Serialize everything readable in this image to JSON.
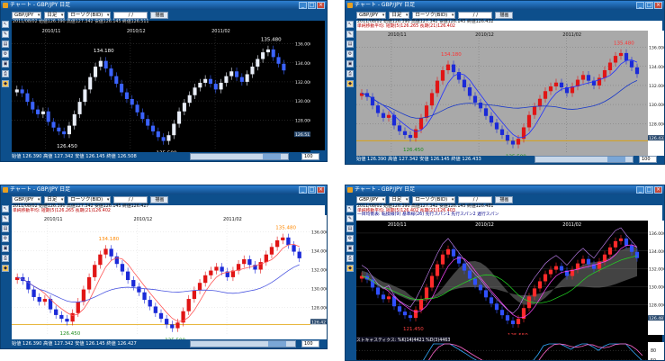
{
  "windows": [
    {
      "id": "w1",
      "title": "チャート - GBP/JPY 日足",
      "symbol": "GBP/JPY",
      "period": "日足",
      "candle_type": "ローソク(BID)",
      "date_value": "/ /",
      "action": "描画",
      "info_lines": [
        "2011/08/02 始値126.390 高値127.342 安値126.145 終値126.511"
      ],
      "xlabels": [
        "2010/11",
        "2010/12",
        "2011/02"
      ],
      "ylabels": [
        "136.000",
        "134.000",
        "132.000",
        "130.000",
        "128.000"
      ],
      "hi_label": "135.480",
      "lo_label": "125.500",
      "mid_label": "134.180",
      "low2_label": "126.450",
      "last_value": "126.511",
      "stats": "始値 126.390  高値 127.342  安値 126.145  終値 126.508",
      "zoom": "100"
    },
    {
      "id": "w2",
      "title": "チャート - GBP/JPY 日足",
      "symbol": "GBP/JPY",
      "period": "日足",
      "candle_type": "ローソク(BID)",
      "date_value": "/ /",
      "action": "描画",
      "info_lines": [
        "2011/08/02 始値126.390 高値127.342 安値126.145 終値126.432",
        "単純移動平均: 短期(5)126.265 長期(21)126.402"
      ],
      "xlabels": [
        "2010/11",
        "2010/12",
        "2011/02"
      ],
      "ylabels": [
        "136.000",
        "134.000",
        "132.000",
        "130.000",
        "128.000"
      ],
      "hi_label": "135.480",
      "lo_label": "125.500",
      "mid_label": "134.180",
      "low2_label": "126.450",
      "last_value": "126.432",
      "stats": "始値 126.390  高値 127.342  安値 126.145  終値 126.433",
      "zoom": "100"
    },
    {
      "id": "w3",
      "title": "チャート - GBP/JPY 日足",
      "symbol": "GBP/JPY",
      "period": "日足",
      "candle_type": "ローソク(BID)",
      "date_value": "/ /",
      "action": "描画",
      "info_lines": [
        "2011/08/02 始値126.390 高値127.342 安値126.145 終値126.427",
        "単純移動平均: 短期(5)126.265 長期(21)126.402"
      ],
      "xlabels": [
        "2010/11",
        "2010/12",
        "2011/02"
      ],
      "ylabels": [
        "136.000",
        "134.000",
        "132.000",
        "130.000",
        "128.000"
      ],
      "hi_label": "135.480",
      "lo_label": "125.500",
      "mid_label": "134.180",
      "low2_label": "126.450",
      "last_value": "126.427",
      "stats": "始値 126.390  高値 127.342  安値 126.145  終値 126.427",
      "zoom": "100"
    },
    {
      "id": "w4",
      "title": "チャート - GBP/JPY 日足",
      "symbol": "GBP/JPY",
      "period": "日足",
      "candle_type": "ローソク(BID)",
      "date_value": "/ /",
      "action": "描画",
      "info_lines": [
        "2011/08/02 始値126.390 高値127.342 安値126.145 終値126.481",
        "単純移動平均: 短期(5)126.402 長期(21)126.403",
        "一目均衡表: 転換線(9) 基準線(26) 先行スパン1 先行スパン2 遅行スパン"
      ],
      "xlabels": [
        "2010/11",
        "2010/12",
        "2011/02"
      ],
      "ylabels": [
        "136.000",
        "134.000",
        "132.000",
        "130.000",
        "128.000"
      ],
      "hi_label": "",
      "lo_label": "125.550",
      "mid_label": "",
      "low2_label": "121.450",
      "last_value": "126.481",
      "sub_title": "ストキャスティクス: %K(14)4421 %D(3)4463",
      "sub_ylabels": [
        "80",
        "50",
        "20"
      ],
      "stats": "",
      "zoom": ""
    }
  ],
  "chart_data": [
    {
      "type": "candlestick",
      "title": "GBP/JPY 日足",
      "x": [
        "2010/11",
        "2010/12",
        "2011/02"
      ],
      "ylim": [
        125.0,
        137.0
      ],
      "series": [
        {
          "close": [
            131.2,
            130.8,
            129.9,
            129.1,
            128.6,
            128.9,
            127.8,
            127.2,
            126.8,
            126.5,
            127.4,
            128.6,
            129.9,
            131.2,
            132.5,
            133.6,
            134.2,
            133.4,
            132.6,
            131.8,
            130.9,
            130.2,
            129.6,
            128.8,
            128.1,
            127.4,
            126.8,
            126.2,
            125.8,
            126.4,
            127.6,
            128.9,
            129.8,
            130.6,
            131.4,
            131.9,
            132.3,
            131.8,
            131.2,
            131.9,
            132.6,
            133.1,
            132.5,
            132.0,
            132.8,
            133.6,
            134.4,
            135.1,
            135.4,
            134.6,
            133.9,
            133.2
          ]
        }
      ],
      "annotations": [
        "134.180",
        "126.450",
        "125.500",
        "135.480"
      ]
    }
  ]
}
